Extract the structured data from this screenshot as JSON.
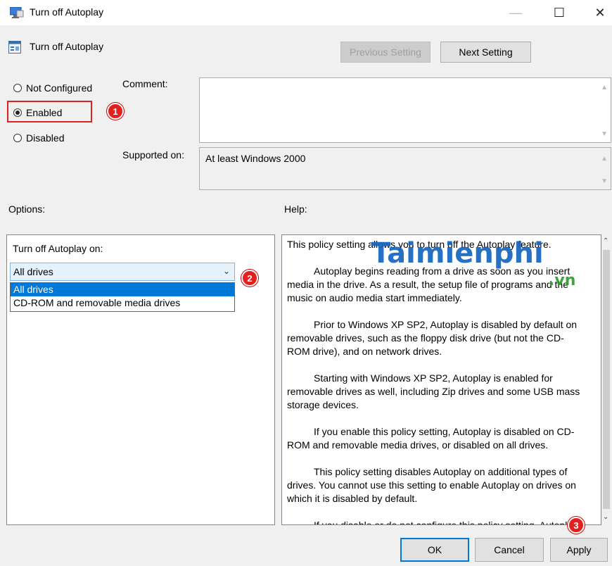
{
  "window": {
    "title": "Turn off Autoplay",
    "minimize": "—",
    "maximize": "☐",
    "close": "✕"
  },
  "header": {
    "policy_name": "Turn off Autoplay",
    "previous_setting": "Previous Setting",
    "next_setting": "Next Setting"
  },
  "state": {
    "options": [
      {
        "label": "Not Configured",
        "checked": false
      },
      {
        "label": "Enabled",
        "checked": true
      },
      {
        "label": "Disabled",
        "checked": false
      }
    ]
  },
  "comment": {
    "label": "Comment:",
    "value": ""
  },
  "supported": {
    "label": "Supported on:",
    "value": "At least Windows 2000"
  },
  "options_section": {
    "label": "Options:",
    "field_label": "Turn off Autoplay on:",
    "selected": "All drives",
    "dropdown_items": [
      "All drives",
      "CD-ROM and removable media drives"
    ]
  },
  "help": {
    "label": "Help:",
    "paragraphs": [
      "This policy setting allows you to turn off the Autoplay feature.",
      "Autoplay begins reading from a drive as soon as you insert media in the drive. As a result, the setup file of programs and the music on audio media start immediately.",
      "Prior to Windows XP SP2, Autoplay is disabled by default on removable drives, such as the floppy disk drive (but not the CD-ROM drive), and on network drives.",
      "Starting with Windows XP SP2, Autoplay is enabled for removable drives as well, including Zip drives and some USB mass storage devices.",
      "If you enable this policy setting, Autoplay is disabled on CD-ROM and removable media drives, or disabled on all drives.",
      "This policy setting disables Autoplay on additional types of drives. You cannot use this setting to enable Autoplay on drives on which it is disabled by default.",
      "If you disable or do not configure this policy setting, Autoplay is enabled."
    ]
  },
  "footer": {
    "ok": "OK",
    "cancel": "Cancel",
    "apply": "Apply"
  },
  "annotations": {
    "step1": "1",
    "step2": "2",
    "step3": "3"
  },
  "watermark": {
    "brand": "Taimienphi",
    "suffix": ".vn"
  },
  "colors": {
    "highlight_box": "#e32020",
    "accent": "#0078d7",
    "badge": "#e32020"
  }
}
